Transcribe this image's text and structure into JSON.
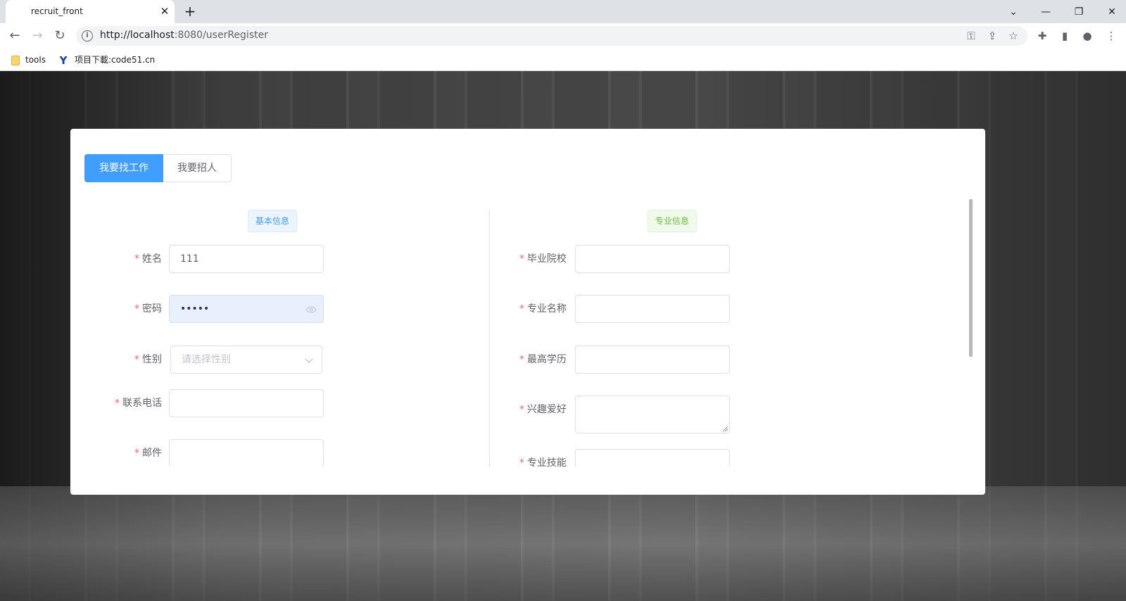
{
  "browser": {
    "tab_title": "recruit_front",
    "url_host": "http://localhost",
    "url_rest": ":8080/userRegister",
    "bookmarks": [
      "tools",
      "项目下載:code51.cn"
    ]
  },
  "tabs": {
    "seeker": "我要找工作",
    "employer": "我要招人"
  },
  "sections": {
    "basic": "基本信息",
    "professional": "专业信息"
  },
  "left_fields": {
    "name": {
      "label": "姓名",
      "value": "111"
    },
    "password": {
      "label": "密码",
      "value": "•••••"
    },
    "gender": {
      "label": "性别",
      "placeholder": "请选择性别"
    },
    "phone": {
      "label": "联系电话",
      "value": ""
    },
    "email": {
      "label": "邮件",
      "value": ""
    }
  },
  "right_fields": {
    "school": {
      "label": "毕业院校",
      "value": ""
    },
    "major": {
      "label": "专业名称",
      "value": ""
    },
    "education": {
      "label": "最高学历",
      "value": ""
    },
    "hobbies": {
      "label": "兴趣爱好",
      "value": ""
    },
    "skills": {
      "label": "专业技能",
      "value": ""
    }
  },
  "required_mark": "*",
  "colors": {
    "primary": "#409eff",
    "success": "#67c23a",
    "danger": "#f56c6c"
  }
}
